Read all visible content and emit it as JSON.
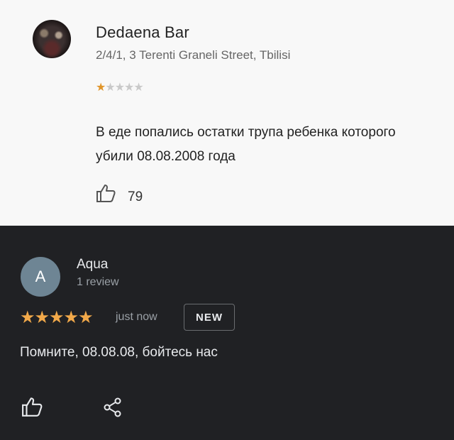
{
  "top_review": {
    "place_name": "Dedaena Bar",
    "address": "2/4/1, 3 Terenti Graneli Street, Tbilisi",
    "rating": 1,
    "rating_max": 5,
    "text": "В еде попались остатки трупа ребенка которого убили 08.08.2008 года",
    "like_count": "79",
    "colors": {
      "star_on": "#e0952a",
      "star_off": "#c9c9c9",
      "background": "#f8f8f8"
    }
  },
  "bottom_review": {
    "avatar_letter": "A",
    "author": "Aqua",
    "review_count": "1 review",
    "rating": 5,
    "rating_max": 5,
    "time": "just now",
    "badge": "NEW",
    "text": "Помните, 08.08.08, бойтесь нас",
    "colors": {
      "star_on": "#f2a94a",
      "background": "#202124",
      "avatar": "#6e8594"
    }
  },
  "icons": [
    "thumbs-up-icon",
    "share-icon"
  ]
}
